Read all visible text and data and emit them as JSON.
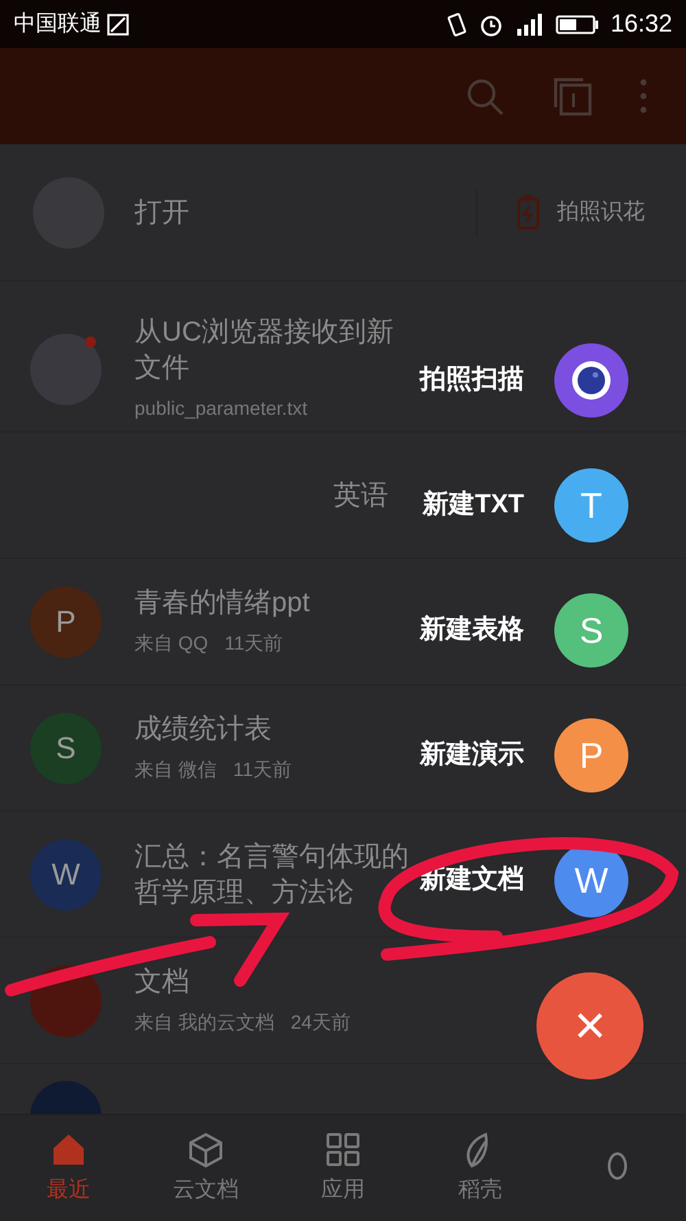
{
  "status_bar": {
    "carrier": "中国联通",
    "time": "16:32"
  },
  "open_row": {
    "label": "打开",
    "action": "拍照识花"
  },
  "files": [
    {
      "title": "从UC浏览器接收到新文件",
      "subtitle": "public_parameter.txt",
      "kind": "notice",
      "unread": true
    },
    {
      "title": "英语",
      "kind": "blank",
      "unread": false
    },
    {
      "title": "青春的情绪ppt",
      "source": "来自 QQ",
      "time": "11天前",
      "kind": "presentation",
      "letter": "P",
      "unread": false
    },
    {
      "title": "成绩统计表",
      "source": "来自 微信",
      "time": "11天前",
      "kind": "sheet",
      "letter": "S",
      "unread": false
    },
    {
      "title": "汇总：名言警句体现的哲学原理、方法论",
      "kind": "doc",
      "letter": "W",
      "unread": false
    },
    {
      "title": "文档",
      "source": "来自 我的云文档",
      "time": "24天前",
      "kind": "pdf",
      "unread": false
    }
  ],
  "fab_menu": [
    {
      "label": "拍照扫描",
      "kind": "camera",
      "color": "#7b4fe0"
    },
    {
      "label": "新建TXT",
      "kind": "letter",
      "letter": "T",
      "color": "#48adf0"
    },
    {
      "label": "新建表格",
      "kind": "letter",
      "letter": "S",
      "color": "#55bf7c"
    },
    {
      "label": "新建演示",
      "kind": "letter",
      "letter": "P",
      "color": "#f48f48"
    },
    {
      "label": "新建文档",
      "kind": "letter",
      "letter": "W",
      "color": "#4d8bef"
    }
  ],
  "close_button": {
    "label": "×"
  },
  "bottom_nav": [
    {
      "label": "最近",
      "kind": "home",
      "selected": true
    },
    {
      "label": "云文档",
      "kind": "cloud",
      "selected": false
    },
    {
      "label": "应用",
      "kind": "apps",
      "selected": false
    },
    {
      "label": "稻壳",
      "kind": "store",
      "selected": false
    },
    {
      "kind": "me",
      "selected": false
    }
  ]
}
